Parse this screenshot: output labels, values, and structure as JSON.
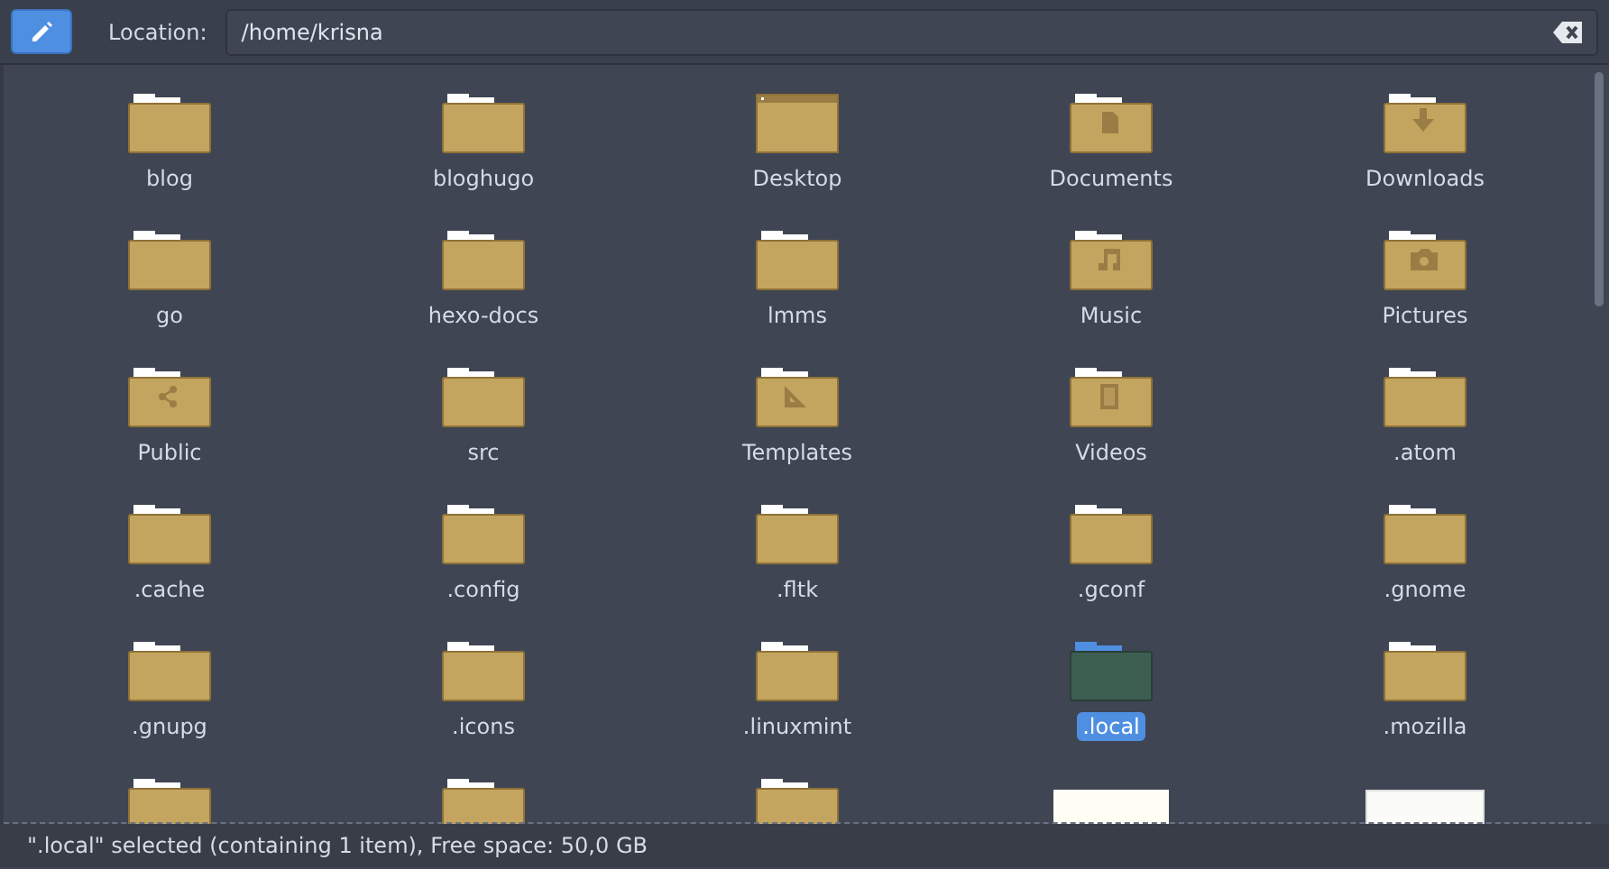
{
  "toolbar": {
    "location_label": "Location:",
    "path": "/home/krisna"
  },
  "items": [
    {
      "name": "blog",
      "kind": "folder",
      "selected": false
    },
    {
      "name": "bloghugo",
      "kind": "folder",
      "selected": false
    },
    {
      "name": "Desktop",
      "kind": "desktop",
      "selected": false
    },
    {
      "name": "Documents",
      "kind": "documents",
      "selected": false
    },
    {
      "name": "Downloads",
      "kind": "downloads",
      "selected": false
    },
    {
      "name": "go",
      "kind": "folder",
      "selected": false
    },
    {
      "name": "hexo-docs",
      "kind": "folder",
      "selected": false
    },
    {
      "name": "lmms",
      "kind": "folder",
      "selected": false
    },
    {
      "name": "Music",
      "kind": "music",
      "selected": false
    },
    {
      "name": "Pictures",
      "kind": "pictures",
      "selected": false
    },
    {
      "name": "Public",
      "kind": "public",
      "selected": false
    },
    {
      "name": "src",
      "kind": "folder",
      "selected": false
    },
    {
      "name": "Templates",
      "kind": "templates",
      "selected": false
    },
    {
      "name": "Videos",
      "kind": "videos",
      "selected": false
    },
    {
      "name": ".atom",
      "kind": "folder",
      "selected": false
    },
    {
      "name": ".cache",
      "kind": "folder",
      "selected": false
    },
    {
      "name": ".config",
      "kind": "folder",
      "selected": false
    },
    {
      "name": ".fltk",
      "kind": "folder",
      "selected": false
    },
    {
      "name": ".gconf",
      "kind": "folder",
      "selected": false
    },
    {
      "name": ".gnome",
      "kind": "folder",
      "selected": false
    },
    {
      "name": ".gnupg",
      "kind": "folder",
      "selected": false
    },
    {
      "name": ".icons",
      "kind": "folder",
      "selected": false
    },
    {
      "name": ".linuxmint",
      "kind": "folder",
      "selected": false
    },
    {
      "name": ".local",
      "kind": "folder",
      "selected": true
    },
    {
      "name": ".mozilla",
      "kind": "folder",
      "selected": false
    },
    {
      "kind": "folder",
      "selected": false
    },
    {
      "kind": "folder",
      "selected": false
    },
    {
      "kind": "folder",
      "selected": false
    },
    {
      "kind": "image",
      "selected": false
    },
    {
      "kind": "drawing",
      "selected": false
    }
  ],
  "status_bar": "\".local\" selected (containing 1 item), Free space: 50,0 GB"
}
